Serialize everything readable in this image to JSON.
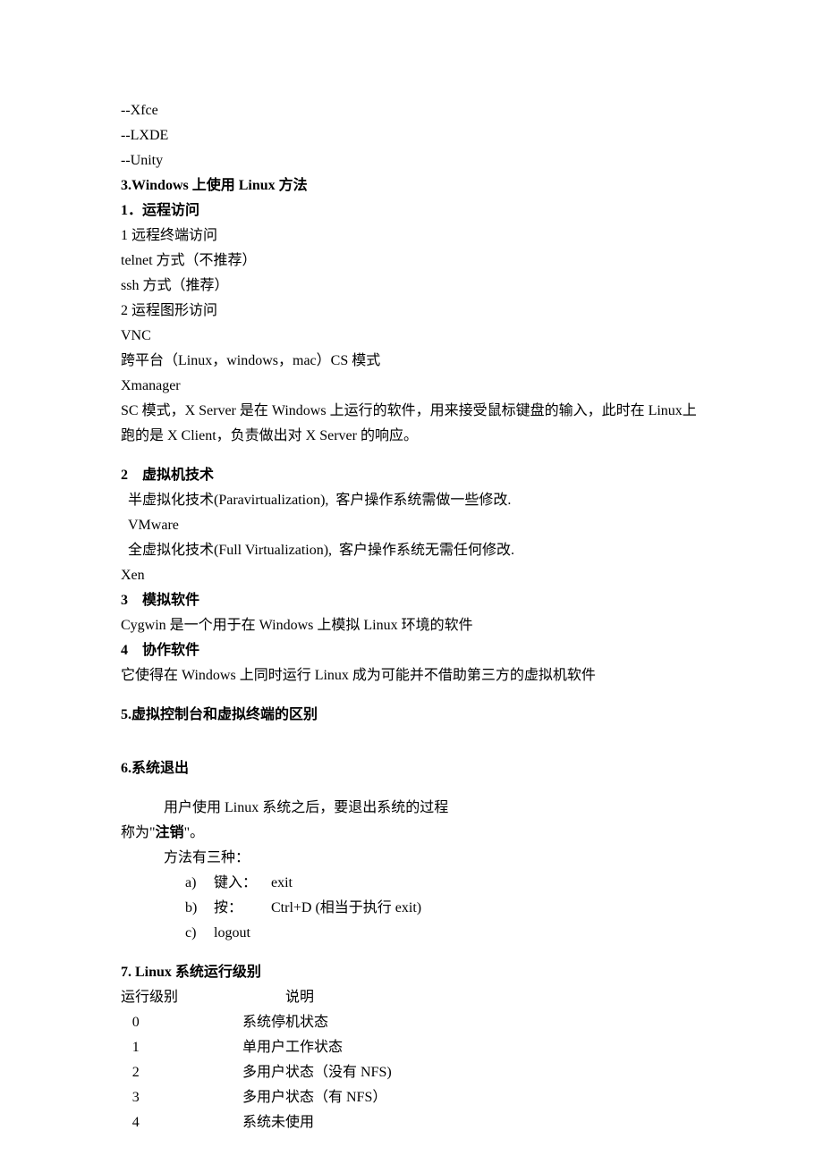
{
  "intro": {
    "xfce": "--Xfce",
    "lxde": "--LXDE",
    "unity": "--Unity"
  },
  "sec3": {
    "title": "3.Windows 上使用 Linux 方法",
    "s1_title": "1．运程访问",
    "s1_l1": "1  远程终端访问",
    "s1_l2": "telnet 方式（不推荐）",
    "s1_l3": "ssh 方式（推荐）",
    "s1_l4": "2  运程图形访问",
    "s1_l5": "VNC",
    "s1_l6": "跨平台（Linux，windows，mac）CS 模式",
    "s1_l7": "Xmanager",
    "s1_l8": "SC 模式，X Server 是在 Windows 上运行的软件，用来接受鼠标键盘的输入，此时在 Linux上跑的是 X Client，负责做出对 X Server 的响应。",
    "s2_title": "2　虚拟机技术",
    "s2_l1": "  半虚拟化技术(Paravirtualization),  客户操作系统需做一些修改.",
    "s2_l2": "  VMware",
    "s2_l3": "  全虚拟化技术(Full Virtualization),  客户操作系统无需任何修改.",
    "s2_l4": "Xen",
    "s3_title": "3　模拟软件",
    "s3_l1": "Cygwin 是一个用于在 Windows 上模拟 Linux 环境的软件",
    "s4_title": "4　协作软件",
    "s4_l1": "它使得在 Windows 上同时运行 Linux 成为可能并不借助第三方的虚拟机软件"
  },
  "sec5": {
    "title": "5.虚拟控制台和虚拟终端的区别"
  },
  "sec6": {
    "title": "6.系统退出",
    "l1_a": "用户使用 Linux 系统之后，要退出系统的过程",
    "l1_b_pre": "称为\"",
    "l1_b_bold": "注销",
    "l1_b_post": "\"。",
    "l2": "方法有三种：",
    "items": [
      {
        "marker": "a)",
        "label": "键入：",
        "desc": "exit"
      },
      {
        "marker": "b)",
        "label": "按：",
        "desc": "Ctrl+D (相当于执行 exit)"
      },
      {
        "marker": "c)",
        "label": "logout",
        "desc": ""
      }
    ]
  },
  "sec7": {
    "title": "7. Linux  系统运行级别",
    "header": {
      "a": "运行级别",
      "b": "说明"
    },
    "rows": [
      {
        "a": "0",
        "b": "系统停机状态"
      },
      {
        "a": "1",
        "b": "单用户工作状态"
      },
      {
        "a": "2",
        "b": "多用户状态（没有 NFS)"
      },
      {
        "a": "3",
        "b": "多用户状态（有 NFS）"
      },
      {
        "a": "4",
        "b": "系统未使用"
      }
    ]
  }
}
